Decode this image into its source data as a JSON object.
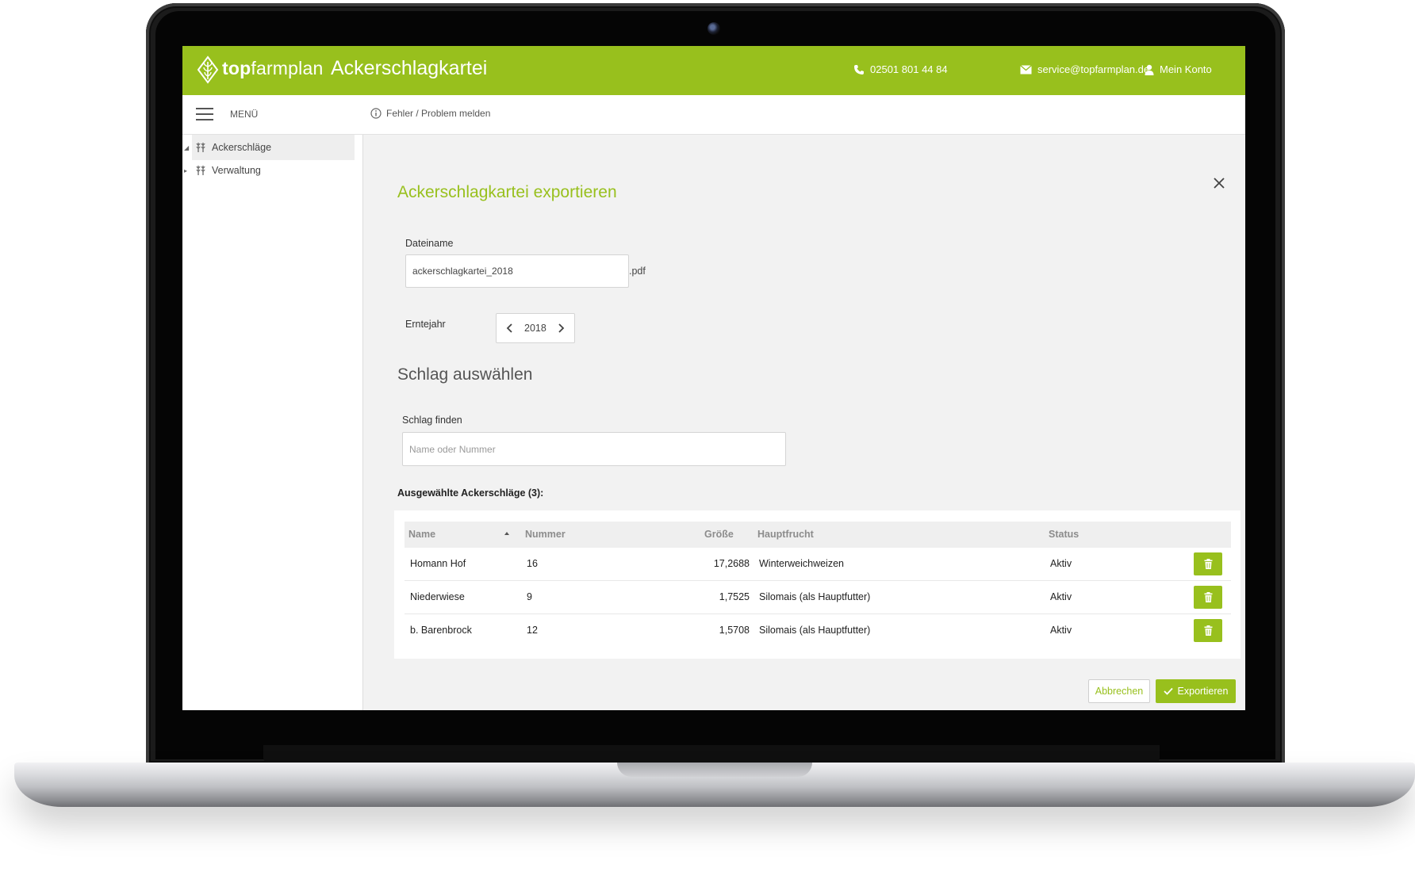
{
  "header": {
    "logo_bold": "top",
    "logo_regular": "farmplan",
    "app_title": "Ackerschlagkartei",
    "phone": "02501 801 44 84",
    "email": "service@topfarmplan.de",
    "account": "Mein Konto",
    "brand_color": "#98c01d"
  },
  "subbar": {
    "menu_label": "MENÜ",
    "report_link": "Fehler / Problem melden"
  },
  "sidebar": {
    "items": [
      {
        "label": "Ackerschläge",
        "icon": "fields-icon",
        "expanded": true
      },
      {
        "label": "Verwaltung",
        "icon": "fields-icon",
        "expanded": false
      }
    ]
  },
  "dialog": {
    "title": "Ackerschlagkartei exportieren",
    "filename_label": "Dateiname",
    "filename_value": "ackerschlagkartei_2018",
    "filename_suffix": ".pdf",
    "year_label": "Erntejahr",
    "year_value": "2018",
    "section_title": "Schlag auswählen",
    "search_label": "Schlag finden",
    "search_placeholder": "Name oder Nummer",
    "selected_title": "Ausgewählte Ackerschläge (3):",
    "cancel_label": "Abbrechen",
    "export_label": "Exportieren"
  },
  "table": {
    "columns": [
      "Name",
      "Nummer",
      "Größe",
      "Hauptfrucht",
      "Status"
    ],
    "rows": [
      {
        "name": "Homann Hof",
        "nummer": "16",
        "groesse": "17,2688",
        "hauptfrucht": "Winterweichweizen",
        "status": "Aktiv"
      },
      {
        "name": "Niederwiese",
        "nummer": "9",
        "groesse": "1,7525",
        "hauptfrucht": "Silomais (als Hauptfutter)",
        "status": "Aktiv"
      },
      {
        "name": "b. Barenbrock",
        "nummer": "12",
        "groesse": "1,5708",
        "hauptfrucht": "Silomais (als Hauptfutter)",
        "status": "Aktiv"
      }
    ]
  }
}
